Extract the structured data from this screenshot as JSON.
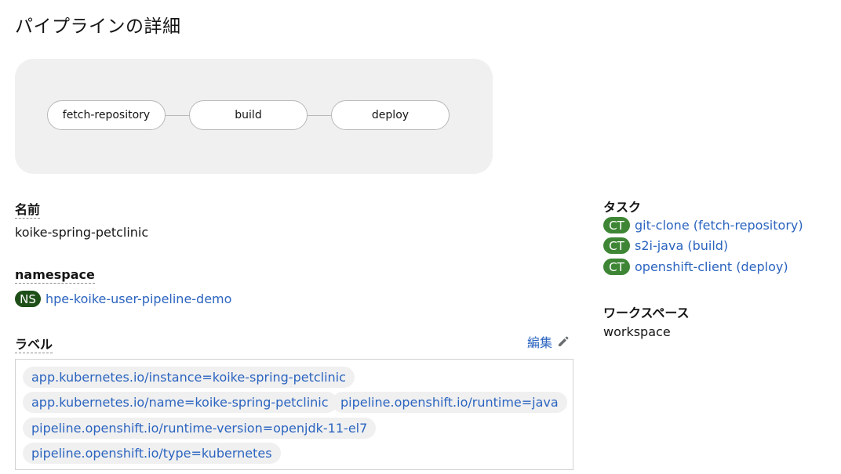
{
  "page_title": "パイプラインの詳細",
  "pipeline_nodes": [
    "fetch-repository",
    "build",
    "deploy"
  ],
  "name": {
    "label": "名前",
    "value": "koike-spring-petclinic"
  },
  "namespace": {
    "label": "namespace",
    "badge": "NS",
    "value": "hpe-koike-user-pipeline-demo"
  },
  "labels": {
    "label": "ラベル",
    "edit": "編集",
    "items": [
      "app.kubernetes.io/instance=koike-spring-petclinic",
      "app.kubernetes.io/name=koike-spring-petclinic",
      "pipeline.openshift.io/runtime=java",
      "pipeline.openshift.io/runtime-version=openjdk-11-el7",
      "pipeline.openshift.io/type=kubernetes"
    ]
  },
  "tasks": {
    "label": "タスク",
    "badge": "CT",
    "items": [
      "git-clone (fetch-repository)",
      "s2i-java (build)",
      "openshift-client (deploy)"
    ]
  },
  "workspaces": {
    "label": "ワークスペース",
    "value": "workspace"
  },
  "colors": {
    "link": "#2b64c0",
    "ns_badge": "#1e4f18",
    "ct_badge": "#3e8635",
    "chip_bg": "#f0f0f0"
  }
}
